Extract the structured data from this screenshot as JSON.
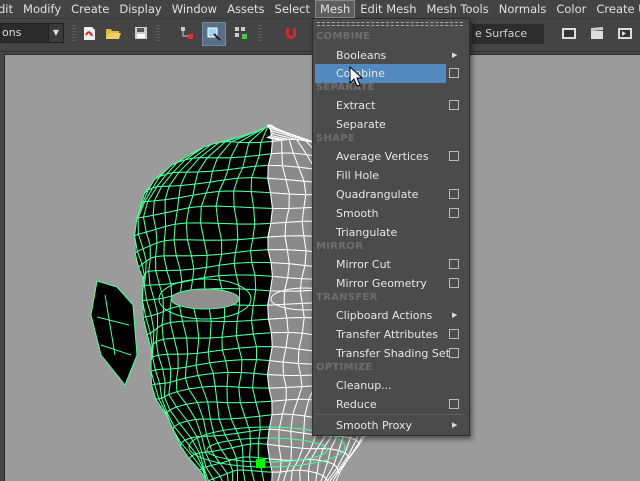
{
  "menubar": {
    "items": [
      "dit",
      "Modify",
      "Create",
      "Display",
      "Window",
      "Assets",
      "Select",
      "Mesh",
      "Edit Mesh",
      "Mesh Tools",
      "Normals",
      "Color",
      "Create UVs"
    ],
    "active_index": 7
  },
  "toolbar": {
    "mode_value": "ons",
    "surface_label": "e Surface",
    "icons": [
      "red-dot-icon",
      "pdf-icon",
      "open-folder-icon",
      "save-icon",
      "select-hierarchy-icon",
      "select-object-icon",
      "select-component-icon",
      "magnet-snap-icon",
      "render-frame-icon",
      "clapperboard-icon",
      "ipr-render-icon"
    ]
  },
  "mesh_menu": {
    "sections": [
      {
        "title": "COMBINE",
        "items": [
          {
            "label": "Booleans",
            "submenu": true
          },
          {
            "label": "Combine",
            "option": true,
            "highlighted": true
          }
        ]
      },
      {
        "title": "SEPARATE",
        "items": [
          {
            "label": "Extract",
            "option": true
          },
          {
            "label": "Separate"
          }
        ]
      },
      {
        "title": "SHAPE",
        "items": [
          {
            "label": "Average Vertices",
            "option": true
          },
          {
            "label": "Fill Hole"
          },
          {
            "label": "Quadrangulate",
            "option": true
          },
          {
            "label": "Smooth",
            "option": true
          },
          {
            "label": "Triangulate"
          }
        ]
      },
      {
        "title": "MIRROR",
        "items": [
          {
            "label": "Mirror Cut",
            "option": true
          },
          {
            "label": "Mirror Geometry",
            "option": true
          }
        ]
      },
      {
        "title": "TRANSFER",
        "items": [
          {
            "label": "Clipboard Actions",
            "submenu": true
          },
          {
            "label": "Transfer Attributes",
            "option": true
          },
          {
            "label": "Transfer Shading Sets",
            "option": true
          }
        ]
      },
      {
        "title": "OPTIMIZE",
        "items": [
          {
            "label": "Cleanup...",
            "option": false
          },
          {
            "label": "Reduce",
            "option": true
          }
        ]
      }
    ],
    "footer_item": {
      "label": "Smooth Proxy",
      "submenu": true
    }
  },
  "colors": {
    "wire_selected": "#4dff9a",
    "wire_unselected": "#ffffff",
    "face_fill_left": "#000000",
    "face_fill_right": "#8a8a8a",
    "viewport_bg": "#9b9b9b",
    "menu_highlight": "#5289bf",
    "selected_vertex": "#00ff00"
  }
}
